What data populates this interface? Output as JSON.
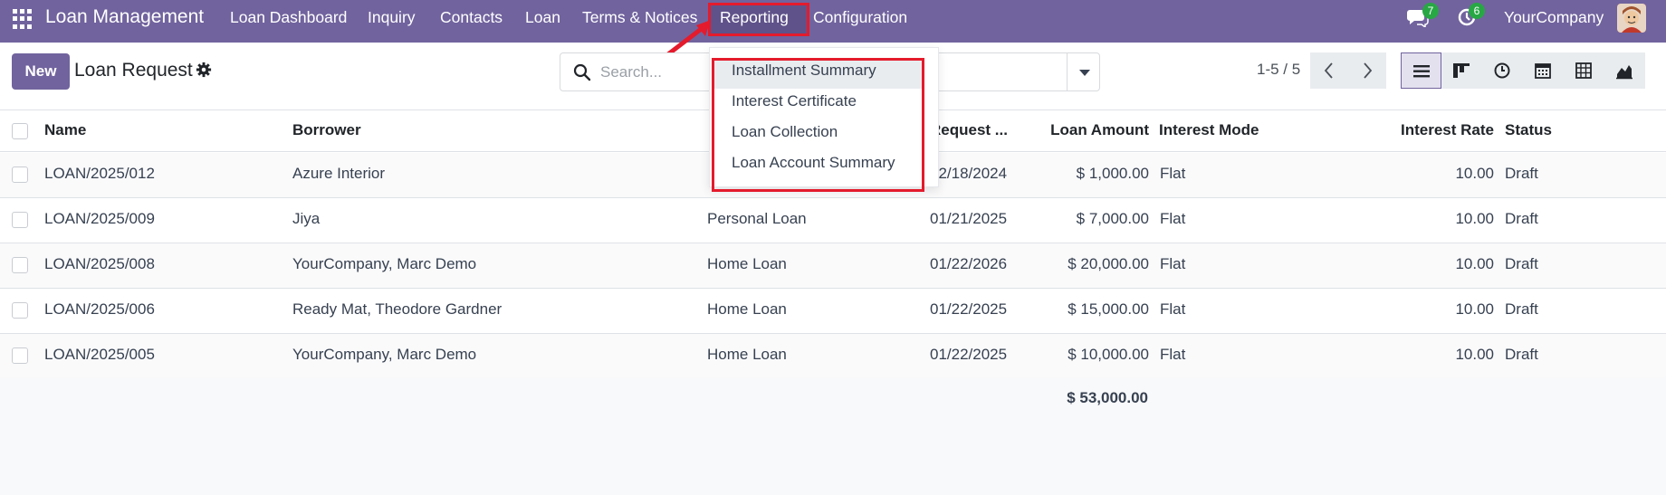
{
  "navbar": {
    "brand": "Loan Management",
    "menu": [
      {
        "label": "Loan Dashboard"
      },
      {
        "label": "Inquiry"
      },
      {
        "label": "Contacts"
      },
      {
        "label": "Loan"
      },
      {
        "label": "Terms & Notices"
      },
      {
        "label": "Reporting"
      },
      {
        "label": "Configuration"
      }
    ],
    "messages_count": "7",
    "activities_count": "6",
    "company": "YourCompany",
    "accent_color": "#71639e",
    "badge_color": "#28a745"
  },
  "reporting_menu": {
    "items": [
      {
        "label": "Installment Summary"
      },
      {
        "label": "Interest Certificate"
      },
      {
        "label": "Loan Collection"
      },
      {
        "label": "Loan Account Summary"
      }
    ],
    "highlight_color": "#e41b2c"
  },
  "control_panel": {
    "new_label": "New",
    "title": "Loan Request",
    "search_placeholder": "Search...",
    "pager": "1-5 / 5",
    "views": [
      "list-view-icon",
      "kanban-view-icon",
      "activity-view-icon",
      "calendar-view-icon",
      "pivot-view-icon",
      "graph-view-icon"
    ]
  },
  "table": {
    "columns": {
      "name": "Name",
      "borrower": "Borrower",
      "request_date": "Request ...",
      "loan_amount": "Loan Amount",
      "interest_mode": "Interest Mode",
      "interest_rate": "Interest Rate",
      "status": "Status"
    },
    "rows": [
      {
        "name": "LOAN/2025/012",
        "borrower": "Azure Interior",
        "type": "",
        "date": "12/18/2024",
        "amount": "$ 1,000.00",
        "mode": "Flat",
        "rate": "10.00",
        "status": "Draft"
      },
      {
        "name": "LOAN/2025/009",
        "borrower": "Jiya",
        "type": "Personal Loan",
        "date": "01/21/2025",
        "amount": "$ 7,000.00",
        "mode": "Flat",
        "rate": "10.00",
        "status": "Draft"
      },
      {
        "name": "LOAN/2025/008",
        "borrower": "YourCompany, Marc Demo",
        "type": "Home Loan",
        "date": "01/22/2026",
        "amount": "$ 20,000.00",
        "mode": "Flat",
        "rate": "10.00",
        "status": "Draft"
      },
      {
        "name": "LOAN/2025/006",
        "borrower": "Ready Mat, Theodore Gardner",
        "type": "Home Loan",
        "date": "01/22/2025",
        "amount": "$ 15,000.00",
        "mode": "Flat",
        "rate": "10.00",
        "status": "Draft"
      },
      {
        "name": "LOAN/2025/005",
        "borrower": "YourCompany, Marc Demo",
        "type": "Home Loan",
        "date": "01/22/2025",
        "amount": "$ 10,000.00",
        "mode": "Flat",
        "rate": "10.00",
        "status": "Draft"
      }
    ],
    "total_amount": "$ 53,000.00"
  }
}
